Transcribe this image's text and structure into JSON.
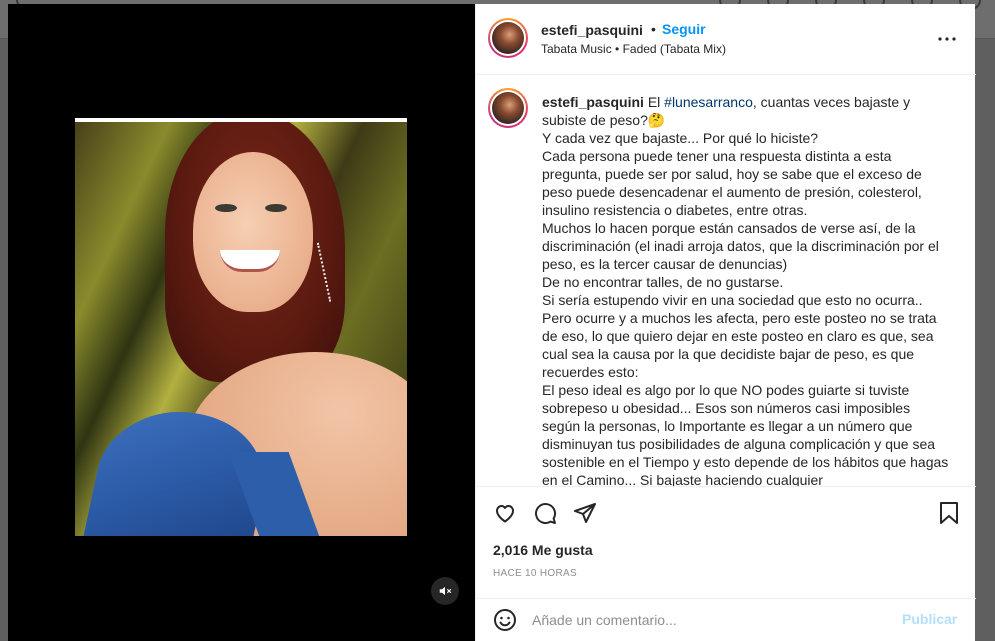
{
  "post": {
    "username": "estefi_pasquini",
    "dot": "•",
    "follow_label": "Seguir",
    "music": "Tabata Music • Faded (Tabata Mix)",
    "caption": {
      "user": "estefi_pasquini",
      "lead": "El ",
      "hashtag": "#lunesarranco",
      "body": ", cuantas veces bajaste y subiste de peso?🤔\nY cada vez que bajaste... Por qué lo hiciste?\nCada persona puede tener una respuesta distinta a esta pregunta, puede ser por salud, hoy se sabe que el exceso de peso puede desencadenar el aumento de presión, colesterol, insulino resistencia o diabetes, entre otras.\nMuchos lo hacen porque están cansados de verse así, de la discriminación (el inadi arroja datos, que la discriminación por el peso, es la tercer causar de denuncias)\nDe no encontrar talles, de no gustarse.\nSi sería estupendo vivir en una sociedad que esto no ocurra..\nPero ocurre y a muchos les afecta, pero este posteo no se trata de eso, lo que quiero dejar en este posteo en claro es que, sea cual sea la causa por la que decidiste bajar de peso, es que recuerdes esto:\nEl peso ideal es algo por lo que NO podes guiarte si tuviste sobrepeso u obesidad... Esos son números casi imposibles según la personas, lo Importante es llegar a un número que disminuyan tus posibilidades de alguna complicación y que sea sostenible en el Tiempo y esto depende de los hábitos que hagas en el Camino... Si bajaste haciendo cualquier"
    },
    "likes": "2,016 Me gusta",
    "time": "HACE 10 HORAS",
    "comment_placeholder": "Añade un comentario...",
    "publish_label": "Publicar"
  },
  "icons": {
    "more": "more-options-icon",
    "like": "heart-icon",
    "comment": "comment-icon",
    "share": "send-icon",
    "save": "bookmark-icon",
    "emoji": "emoji-icon",
    "mute": "muted-speaker-icon"
  },
  "colors": {
    "accent": "#0095f6",
    "publish_disabled": "#b2dffc",
    "hashtag": "#00376b"
  }
}
